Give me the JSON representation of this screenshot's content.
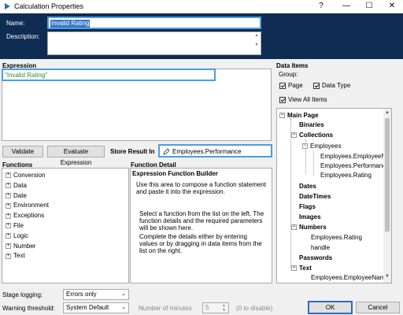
{
  "window": {
    "title": "Calculation Properties",
    "help": "?",
    "minimize": "—",
    "maximize": "☐",
    "close": "✕"
  },
  "header": {
    "name_label": "Name:",
    "name_value": "Invalid Rating",
    "description_label": "Description:",
    "description_value": ""
  },
  "expression": {
    "label": "Expression",
    "value": "\"Invalid Rating\""
  },
  "actions": {
    "validate": "Validate",
    "evaluate": "Evaluate Expression",
    "store_label": "Store Result In",
    "store_value": "Employees.Performance"
  },
  "functions": {
    "label": "Functions",
    "items": [
      "Conversion",
      "Data",
      "Date",
      "Environment",
      "Exceptions",
      "File",
      "Logic",
      "Number",
      "Text"
    ]
  },
  "function_detail": {
    "label": "Function Detail",
    "builder_title": "Expression Function Builder",
    "intro": "Use this area to compose a function statement and paste it into the expression.",
    "p1": "Select a function from the list on the left. The function details and the required parameters will be shown here.",
    "p2": "Complete the details either by entering values or by dragging in data items from the list on the right."
  },
  "data_items": {
    "label": "Data Items",
    "group_label": "Group:",
    "page_label": "Page",
    "datatype_label": "Data Type",
    "viewall_label": "View All Items",
    "tree": {
      "main": "Main Page",
      "binaries": "Binaries",
      "collections": "Collections",
      "employees": "Employees",
      "emp_name": "Employees.EmployeeName",
      "emp_perf": "Employees.Performance",
      "emp_rating": "Employees.Rating",
      "dates": "Dates",
      "datetimes": "DateTimes",
      "flags": "Flags",
      "images": "Images",
      "numbers": "Numbers",
      "num_rating": "Employees.Rating",
      "handle": "handle",
      "passwords": "Passwords",
      "text": "Text",
      "text_emp": "Employees.EmployeeName"
    }
  },
  "footer": {
    "stage_logging_label": "Stage logging:",
    "stage_logging_value": "Errors only",
    "warning_label": "Warning threshold:",
    "warning_value": "System Default",
    "minutes_label": "Number of minutes",
    "minutes_value": "5",
    "disable_hint": "(0 to disable)",
    "ok": "OK",
    "cancel": "Cancel"
  }
}
